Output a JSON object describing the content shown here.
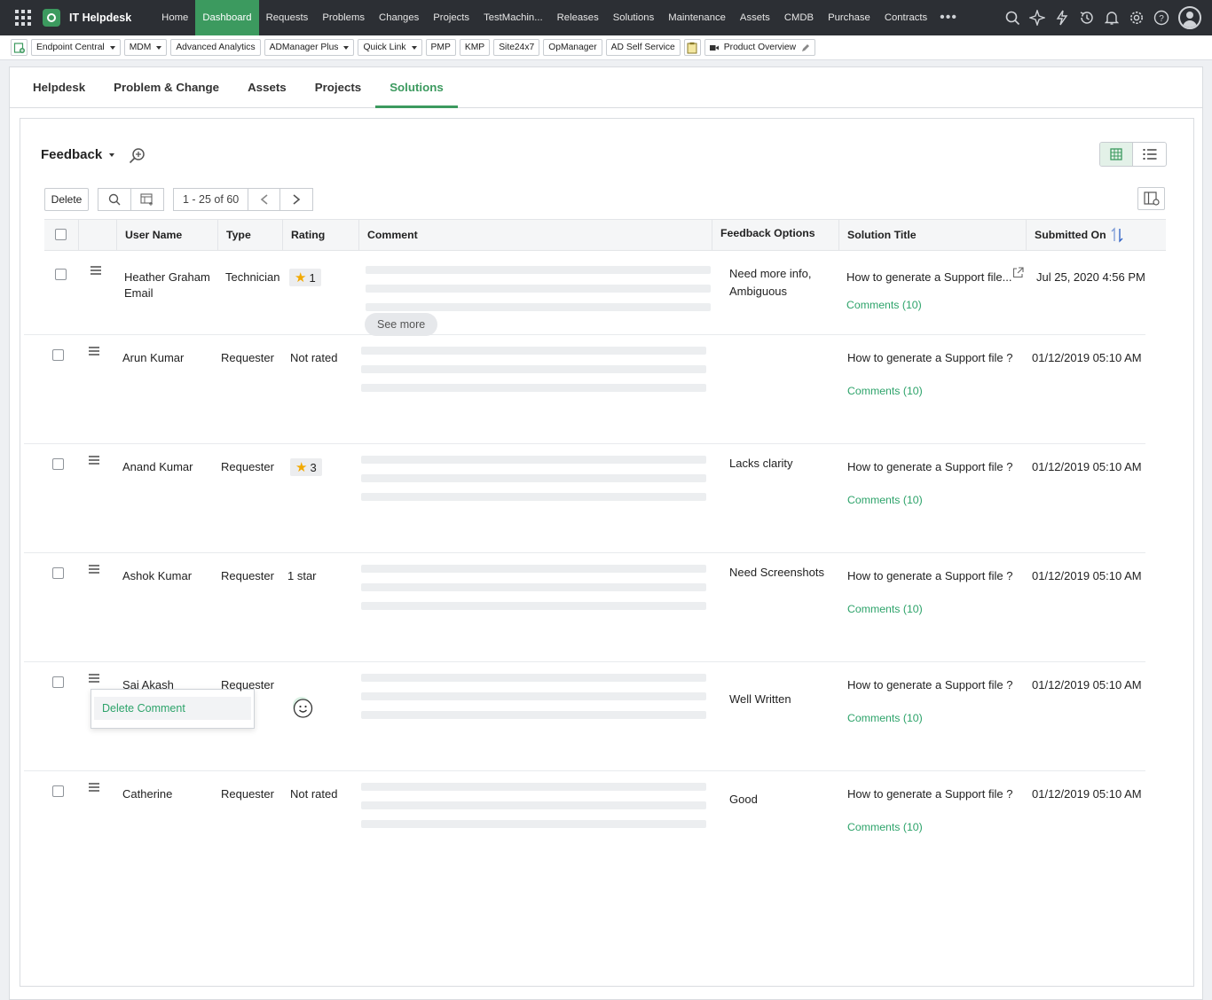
{
  "app": {
    "name": "IT Helpdesk",
    "nav": [
      "Home",
      "Dashboard",
      "Requests",
      "Problems",
      "Changes",
      "Projects",
      "TestMachin...",
      "Releases",
      "Solutions",
      "Maintenance",
      "Assets",
      "CMDB",
      "Purchase",
      "Contracts"
    ],
    "nav_active": "Dashboard",
    "nav_more": "•••",
    "right_icons": [
      "search-icon",
      "sparkle-icon",
      "bolt-icon",
      "history-icon",
      "bell-icon",
      "gear-icon",
      "help-icon",
      "user-avatar-icon"
    ]
  },
  "quicklinks": {
    "items": [
      {
        "label": "Endpoint Central",
        "dropdown": true
      },
      {
        "label": "MDM",
        "dropdown": true
      },
      {
        "label": "Advanced Analytics",
        "dropdown": false
      },
      {
        "label": "ADManager Plus",
        "dropdown": true
      },
      {
        "label": "Quick Link",
        "dropdown": true
      },
      {
        "label": "PMP",
        "dropdown": false
      },
      {
        "label": "KMP",
        "dropdown": false
      },
      {
        "label": "Site24x7",
        "dropdown": false
      },
      {
        "label": "OpManager",
        "dropdown": false
      },
      {
        "label": "AD Self Service",
        "dropdown": false
      }
    ],
    "product_overview": "Product Overview"
  },
  "module_tabs": [
    "Helpdesk",
    "Problem & Change",
    "Assets",
    "Projects",
    "Solutions"
  ],
  "module_active": "Solutions",
  "view": {
    "title": "Feedback"
  },
  "toolbar": {
    "delete_label": "Delete",
    "pager": "1 - 25 of 60"
  },
  "table": {
    "headers": {
      "user": "User Name",
      "type": "Type",
      "rating": "Rating",
      "comment": "Comment",
      "feedback": "Feedback Options",
      "solution": "Solution Title",
      "submitted": "Submitted On"
    },
    "see_more": "See more",
    "rows": [
      {
        "user": "Heather Graham",
        "user2": "Email",
        "type": "Technician",
        "rating": "1",
        "rating_kind": "star",
        "feedback": "Need more info,",
        "feedback2": "Ambiguous",
        "solution": "How to generate a Support file...",
        "comments": "Comments (10)",
        "submitted": "Jul 25, 2020 4:56 PM"
      },
      {
        "user": "Arun Kumar",
        "user2": "",
        "type": "Requester",
        "rating": "Not rated",
        "rating_kind": "text",
        "feedback": "",
        "feedback2": "",
        "solution": "How to generate a Support file ?",
        "comments": "Comments (10)",
        "submitted": "01/12/2019 05:10 AM"
      },
      {
        "user": "Anand Kumar",
        "user2": "",
        "type": "Requester",
        "rating": "3",
        "rating_kind": "star",
        "feedback": "Lacks clarity",
        "feedback2": "",
        "solution": "How to generate a Support file ?",
        "comments": "Comments (10)",
        "submitted": "01/12/2019 05:10 AM"
      },
      {
        "user": "Ashok Kumar",
        "user2": "",
        "type": "Requester",
        "rating": "1 star",
        "rating_kind": "text",
        "feedback": "Need Screenshots",
        "feedback2": "",
        "solution": "How to generate a Support file ?",
        "comments": "Comments (10)",
        "submitted": "01/12/2019 05:10 AM"
      },
      {
        "user": "Sai Akash",
        "user2": "",
        "type": "Requester",
        "rating": "",
        "rating_kind": "smiley",
        "feedback": "Well Written",
        "feedback2": "",
        "solution": "How to generate a Support file ?",
        "comments": "Comments (10)",
        "submitted": "01/12/2019 05:10 AM"
      },
      {
        "user": "Catherine",
        "user2": "",
        "type": "Requester",
        "rating": "Not rated",
        "rating_kind": "text",
        "feedback": "Good",
        "feedback2": "",
        "solution": "How to generate a Support file ?",
        "comments": "Comments (10)",
        "submitted": "01/12/2019 05:10 AM"
      }
    ]
  },
  "context_menu": {
    "delete_comment": "Delete Comment"
  },
  "colors": {
    "accent": "#3c9a5f",
    "link": "#2da36a",
    "topbar": "#2c2f34",
    "star": "#f2a900"
  }
}
